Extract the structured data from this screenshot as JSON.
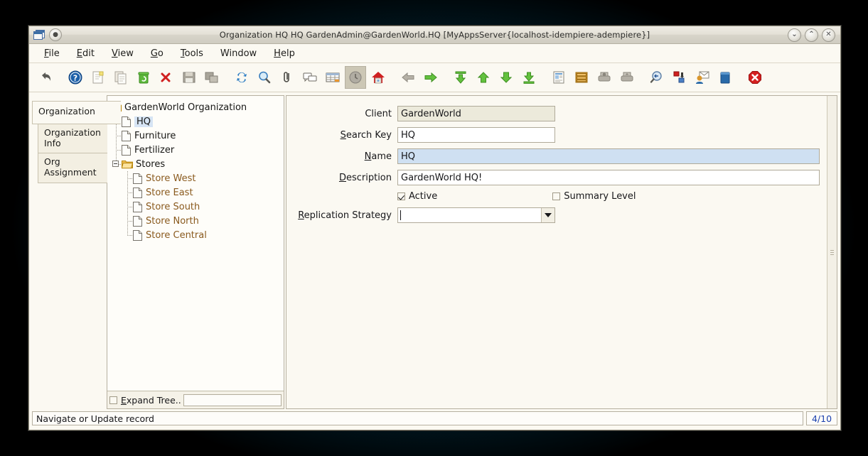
{
  "window": {
    "title": "Organization  HQ  HQ  GardenAdmin@GardenWorld.HQ [MyAppsServer{localhost-idempiere-adempiere}]",
    "system_menu_icon": "window-list-icon",
    "app_icon": "app-round-icon",
    "minimize_label": "⌄",
    "maximize_label": "⌃",
    "close_label": "✕"
  },
  "menubar": {
    "items": [
      {
        "label": "File",
        "mnemonic": "F"
      },
      {
        "label": "Edit",
        "mnemonic": "E"
      },
      {
        "label": "View",
        "mnemonic": "V"
      },
      {
        "label": "Go",
        "mnemonic": "G"
      },
      {
        "label": "Tools",
        "mnemonic": "T"
      },
      {
        "label": "Window",
        "mnemonic": ""
      },
      {
        "label": "Help",
        "mnemonic": "H"
      }
    ]
  },
  "toolbar": {
    "buttons": [
      {
        "name": "undo-icon",
        "selected": false
      },
      {
        "name": "help-icon",
        "selected": false
      },
      {
        "name": "new-record-icon",
        "selected": false
      },
      {
        "name": "copy-record-icon",
        "selected": false
      },
      {
        "name": "delete-icon",
        "selected": false
      },
      {
        "name": "delete-selection-icon",
        "selected": false
      },
      {
        "name": "save-icon",
        "selected": false
      },
      {
        "name": "multi-save-icon",
        "selected": false
      },
      {
        "name": "refresh-icon",
        "selected": false
      },
      {
        "name": "find-icon",
        "selected": false
      },
      {
        "name": "attachment-icon",
        "selected": false
      },
      {
        "name": "chat-icon",
        "selected": false
      },
      {
        "name": "grid-toggle-icon",
        "selected": false
      },
      {
        "name": "history-icon",
        "selected": true
      },
      {
        "name": "home-icon",
        "selected": false
      },
      {
        "name": "back-icon",
        "selected": false
      },
      {
        "name": "forward-icon",
        "selected": false
      },
      {
        "name": "first-record-icon",
        "selected": false
      },
      {
        "name": "previous-record-icon",
        "selected": false
      },
      {
        "name": "next-record-icon",
        "selected": false
      },
      {
        "name": "last-record-icon",
        "selected": false
      },
      {
        "name": "report-icon",
        "selected": false
      },
      {
        "name": "archive-icon",
        "selected": false
      },
      {
        "name": "print-preview-icon",
        "selected": false
      },
      {
        "name": "print-icon",
        "selected": false
      },
      {
        "name": "zoom-across-icon",
        "selected": false
      },
      {
        "name": "workflow-icon",
        "selected": false
      },
      {
        "name": "request-icon",
        "selected": false
      },
      {
        "name": "product-info-icon",
        "selected": false
      },
      {
        "name": "exit-icon",
        "selected": false
      }
    ]
  },
  "tabs": [
    {
      "label": "Organization",
      "name": "tab-organization",
      "active": true,
      "sub": false
    },
    {
      "label": "Organization Info",
      "name": "tab-organization-info",
      "active": false,
      "sub": true
    },
    {
      "label": "Org Assignment",
      "name": "tab-org-assignment",
      "active": false,
      "sub": true
    }
  ],
  "tree": {
    "root": "GardenWorld Organization",
    "nodes": [
      {
        "label": "GardenWorld Organization",
        "level": 0,
        "type": "folder",
        "selected": false,
        "store": false,
        "expander": "none"
      },
      {
        "label": "HQ",
        "level": 1,
        "type": "doc",
        "selected": true,
        "store": false,
        "expander": "none"
      },
      {
        "label": "Furniture",
        "level": 1,
        "type": "doc",
        "selected": false,
        "store": false,
        "expander": "none"
      },
      {
        "label": "Fertilizer",
        "level": 1,
        "type": "doc",
        "selected": false,
        "store": false,
        "expander": "none"
      },
      {
        "label": "Stores",
        "level": 1,
        "type": "folder",
        "selected": false,
        "store": false,
        "expander": "minus"
      },
      {
        "label": "Store West",
        "level": 2,
        "type": "doc",
        "selected": false,
        "store": true,
        "expander": "none"
      },
      {
        "label": "Store East",
        "level": 2,
        "type": "doc",
        "selected": false,
        "store": true,
        "expander": "none"
      },
      {
        "label": "Store South",
        "level": 2,
        "type": "doc",
        "selected": false,
        "store": true,
        "expander": "none"
      },
      {
        "label": "Store North",
        "level": 2,
        "type": "doc",
        "selected": false,
        "store": true,
        "expander": "none"
      },
      {
        "label": "Store Central",
        "level": 2,
        "type": "doc",
        "selected": false,
        "store": true,
        "expander": "none"
      }
    ],
    "footer": {
      "expand_label": "Expand Tree..",
      "expand_mnemonic": "E",
      "expand_checked": false,
      "filter_value": "",
      "filter_placeholder": ""
    }
  },
  "form": {
    "fields": [
      {
        "name": "client",
        "label": "Client",
        "mnemonic": "",
        "value": "GardenWorld",
        "readonly": true,
        "width": "short"
      },
      {
        "name": "search-key",
        "label": "Search Key",
        "mnemonic": "S",
        "value": "HQ",
        "readonly": false,
        "width": "short"
      },
      {
        "name": "name",
        "label": "Name",
        "mnemonic": "N",
        "value": "HQ",
        "readonly": false,
        "highlight": true,
        "width": "wide"
      },
      {
        "name": "description",
        "label": "Description",
        "mnemonic": "D",
        "value": "GardenWorld HQ!",
        "readonly": false,
        "width": "wide"
      }
    ],
    "active": {
      "label": "Active",
      "checked": true
    },
    "summary_level": {
      "label": "Summary Level",
      "checked": false
    },
    "replication_strategy": {
      "label": "Replication Strategy",
      "mnemonic": "R",
      "value": ""
    }
  },
  "statusbar": {
    "message": "Navigate or Update record",
    "record_count": "4/10"
  },
  "colors": {
    "window_bg": "#fbf9f2",
    "selection_blue": "#cfe0f2",
    "store_text": "#8a5a1e",
    "record_count_text": "#1a3fae",
    "readonly_bg": "#eceadb",
    "desktop": "#063345"
  }
}
